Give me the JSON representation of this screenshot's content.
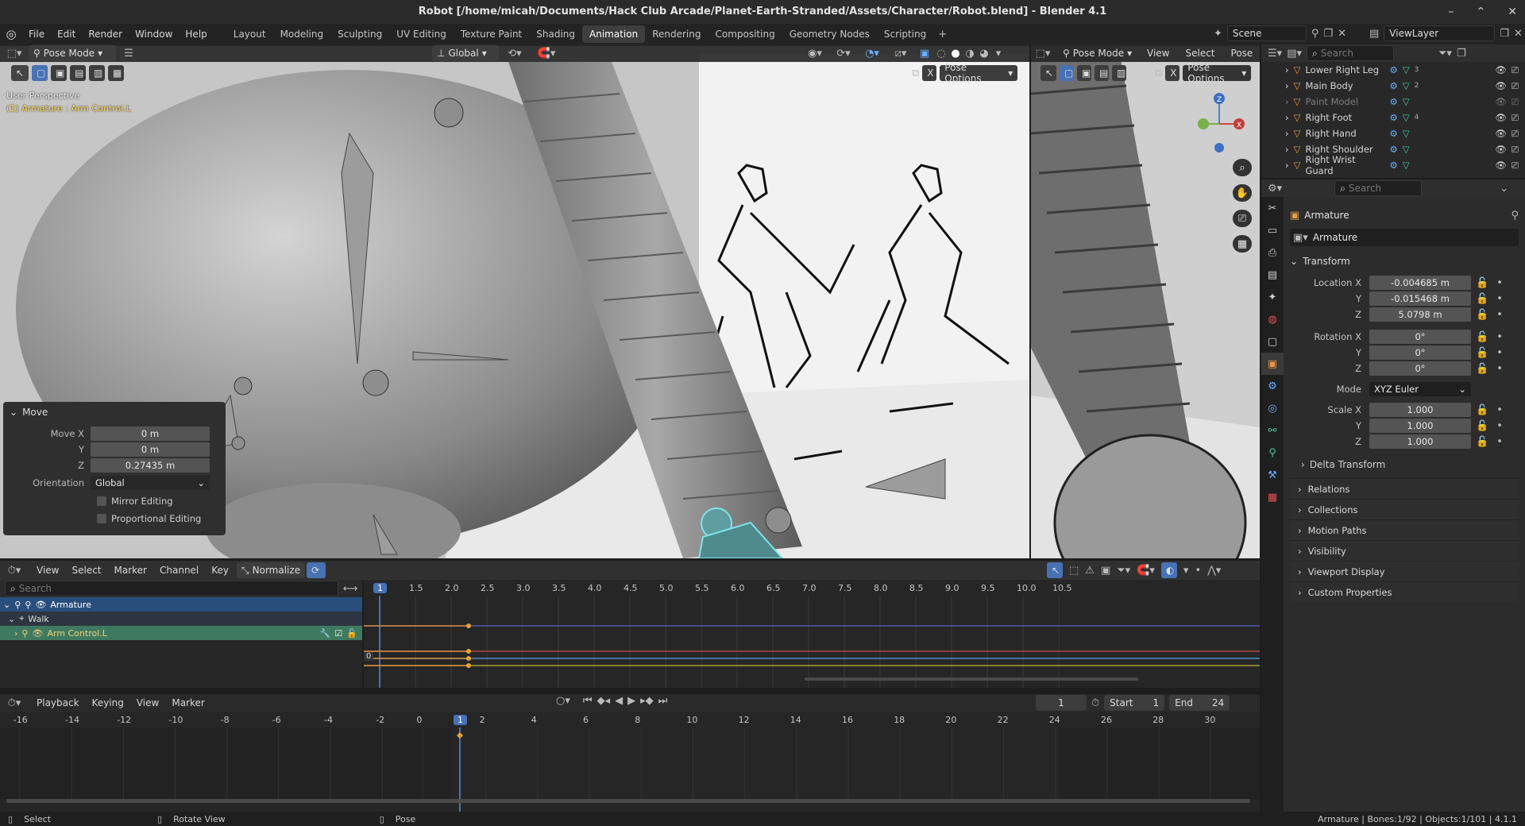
{
  "window": {
    "title": "Robot [/home/micah/Documents/Hack Club Arcade/Planet-Earth-Stranded/Assets/Character/Robot.blend] - Blender 4.1"
  },
  "menus": [
    "File",
    "Edit",
    "Render",
    "Window",
    "Help"
  ],
  "workspaces": [
    {
      "label": "Layout"
    },
    {
      "label": "Modeling"
    },
    {
      "label": "Sculpting"
    },
    {
      "label": "UV Editing"
    },
    {
      "label": "Texture Paint"
    },
    {
      "label": "Shading"
    },
    {
      "label": "Animation"
    },
    {
      "label": "Rendering"
    },
    {
      "label": "Compositing"
    },
    {
      "label": "Geometry Nodes"
    },
    {
      "label": "Scripting"
    }
  ],
  "active_workspace": "Animation",
  "scene": {
    "label": "Scene"
  },
  "view_layer": {
    "label": "ViewLayer"
  },
  "viewport": {
    "mode": "Pose Mode",
    "orientation": "Global",
    "pose_options": "Pose Options",
    "perspective": "User Perspective",
    "active_object": "(1) Armature : Arm Control.L",
    "close_x": "X"
  },
  "move_panel": {
    "title": "Move",
    "move_x_label": "Move X",
    "move_x": "0 m",
    "y_label": "Y",
    "y": "0 m",
    "z_label": "Z",
    "z": "0.27435 m",
    "orientation_label": "Orientation",
    "orientation": "Global",
    "mirror": "Mirror Editing",
    "proportional": "Proportional Editing"
  },
  "viewport2": {
    "mode": "Pose Mode",
    "menus": [
      "View",
      "Select",
      "Pose"
    ],
    "pose_options": "Pose Options",
    "close_x": "X"
  },
  "outliner": {
    "search_placeholder": "Search",
    "items": [
      {
        "label": "Lower Right Leg",
        "dim": false,
        "count": "3"
      },
      {
        "label": "Main Body",
        "dim": false,
        "count": "2"
      },
      {
        "label": "Paint Model",
        "dim": true,
        "count": ""
      },
      {
        "label": "Right Foot",
        "dim": false,
        "count": "4"
      },
      {
        "label": "Right Hand",
        "dim": false,
        "count": ""
      },
      {
        "label": "Right Shoulder",
        "dim": false,
        "count": ""
      },
      {
        "label": "Right Wrist Guard",
        "dim": false,
        "count": ""
      }
    ]
  },
  "properties": {
    "search_placeholder": "Search",
    "object_name": "Armature",
    "data_name": "Armature",
    "transform_label": "Transform",
    "location_x_label": "Location X",
    "location_x": "-0.004685 m",
    "location_y": "-0.015468 m",
    "location_z": "5.0798 m",
    "rotation_x_label": "Rotation X",
    "rotation_x": "0°",
    "rotation_y": "0°",
    "rotation_z": "0°",
    "mode_label": "Mode",
    "mode": "XYZ Euler",
    "scale_x_label": "Scale X",
    "scale_x": "1.000",
    "scale_y": "1.000",
    "scale_z": "1.000",
    "y_label": "Y",
    "z_label": "Z",
    "delta_transform": "Delta Transform",
    "sections": [
      "Relations",
      "Collections",
      "Motion Paths",
      "Visibility",
      "Viewport Display",
      "Custom Properties"
    ]
  },
  "dopesheet": {
    "menus": [
      "View",
      "Select",
      "Marker",
      "Channel",
      "Key"
    ],
    "normalize": "Normalize",
    "search_placeholder": "Search",
    "channels": {
      "armature": "Armature",
      "action": "Walk",
      "bone": "Arm Control.L"
    },
    "ticks": [
      "1",
      "1.5",
      "2.0",
      "2.5",
      "3.0",
      "3.5",
      "4.0",
      "4.5",
      "5.0",
      "5.5",
      "6.0",
      "6.5",
      "7.0",
      "7.5",
      "8.0",
      "8.5",
      "9.0",
      "9.5",
      "10.0",
      "10.5"
    ],
    "value_marker": "0"
  },
  "timeline": {
    "menus": [
      "Playback",
      "Keying",
      "View",
      "Marker"
    ],
    "current_frame": "1",
    "start_label": "Start",
    "start": "1",
    "end_label": "End",
    "end": "24",
    "ticks": [
      "-16",
      "-14",
      "-12",
      "-10",
      "-8",
      "-6",
      "-4",
      "-2",
      "0",
      "1",
      "2",
      "4",
      "6",
      "8",
      "10",
      "12",
      "14",
      "16",
      "18",
      "20",
      "22",
      "24",
      "26",
      "28",
      "30"
    ]
  },
  "status": {
    "select": "Select",
    "rotate_view": "Rotate View",
    "pose": "Pose",
    "info": "Armature | Bones:1/92 | Objects:1/101 | 4.1.1"
  },
  "colors": {
    "accent": "#4772b3",
    "selected_channel": "#3f7a60",
    "keyframe": "#e6a23c",
    "active_text": "#ffd54a"
  }
}
